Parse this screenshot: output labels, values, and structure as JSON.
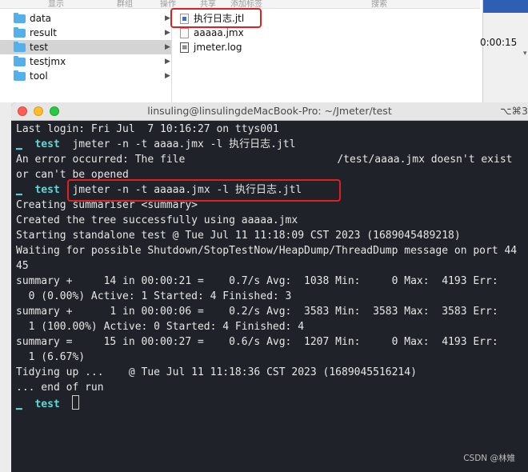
{
  "finder": {
    "toolbar": [
      "显示",
      "群组",
      "操作",
      "共享",
      "添加标签",
      "搜索"
    ],
    "folders": [
      {
        "name": "data",
        "selected": false
      },
      {
        "name": "result",
        "selected": false
      },
      {
        "name": "test",
        "selected": true
      },
      {
        "name": "testjmx",
        "selected": false
      },
      {
        "name": "tool",
        "selected": false
      }
    ],
    "files": [
      {
        "name": "执行日志.jtl",
        "icon": "jtl-file-icon"
      },
      {
        "name": "aaaaa.jmx",
        "icon": "jmx-file-icon"
      },
      {
        "name": "jmeter.log",
        "icon": "log-file-icon"
      }
    ]
  },
  "right_panel": {
    "timer": "0:00:15"
  },
  "terminal": {
    "title": "linsuling@linsulingdeMacBook-Pro: ~/Jmeter/test",
    "shortcut": "⌥⌘3",
    "prompt_symbol": "▁",
    "prompt_dir": "test",
    "lines": [
      "Last login: Fri Jul  7 10:16:27 on ttys001",
      {
        "cmd": "jmeter -n -t aaaa.jmx -l 执行日志.jtl"
      },
      {
        "pre": "An error occurred: The file",
        "post": "/test/aaaa.jmx doesn't exist"
      },
      "or can't be opened",
      {
        "cmd": "jmeter -n -t aaaaa.jmx -l 执行日志.jtl"
      },
      "Creating summariser <summary>",
      "Created the tree successfully using aaaaa.jmx",
      "Starting standalone test @ Tue Jul 11 11:18:09 CST 2023 (1689045489218)",
      "Waiting for possible Shutdown/StopTestNow/HeapDump/ThreadDump message on port 44",
      "45",
      "summary +     14 in 00:00:21 =    0.7/s Avg:  1038 Min:     0 Max:  4193 Err:",
      "  0 (0.00%) Active: 1 Started: 4 Finished: 3",
      "summary +      1 in 00:00:06 =    0.2/s Avg:  3583 Min:  3583 Max:  3583 Err:",
      "  1 (100.00%) Active: 0 Started: 4 Finished: 4",
      "summary =     15 in 00:00:27 =    0.6/s Avg:  1207 Min:     0 Max:  4193 Err:",
      "  1 (6.67%)",
      "Tidying up ...    @ Tue Jul 11 11:18:36 CST 2023 (1689045516214)",
      "... end of run",
      {
        "cmd": ""
      }
    ]
  },
  "watermark": "CSDN @林雉"
}
